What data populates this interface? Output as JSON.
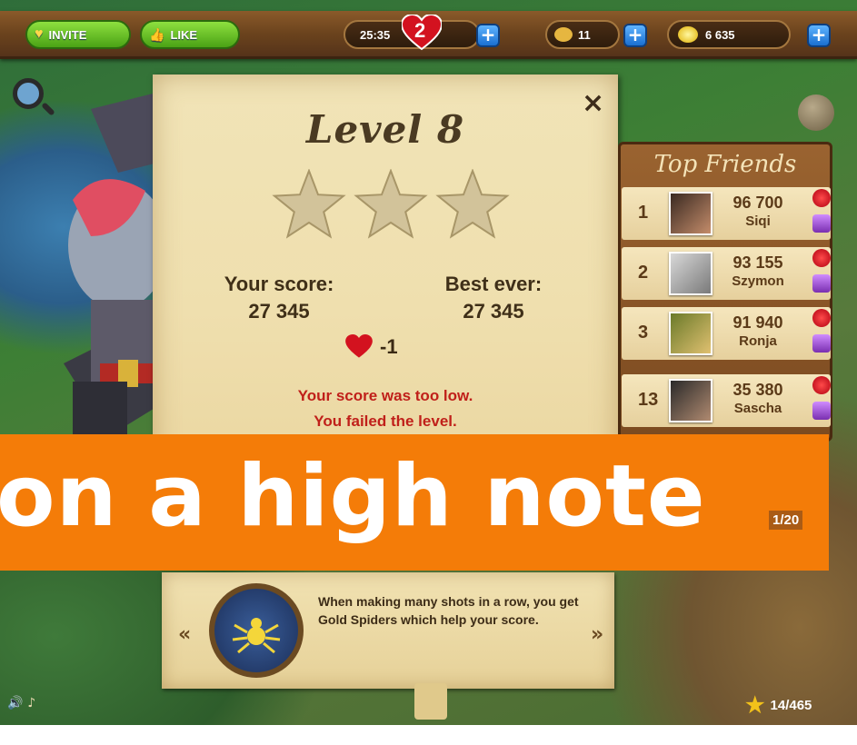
{
  "topbar": {
    "invite_label": "INVITE",
    "like_label": "LIKE",
    "timer": "25:35",
    "lives": "2",
    "tickets": "11",
    "coins": "6 635",
    "plus_symbol": "+"
  },
  "dialog": {
    "title": "Level 8",
    "close_symbol": "×",
    "stars_earned": 0,
    "stars_total": 3,
    "your_score_label": "Your score:",
    "your_score": "27 345",
    "best_ever_label": "Best ever:",
    "best_ever": "27 345",
    "lives_change": "-1",
    "fail_line1": "Your score was too low.",
    "fail_line2": "You failed the level."
  },
  "friends": {
    "title": "Top Friends",
    "rows": [
      {
        "rank": "1",
        "score": "96 700",
        "name": "Siqi"
      },
      {
        "rank": "2",
        "score": "93 155",
        "name": "Szymon"
      },
      {
        "rank": "3",
        "score": "91 940",
        "name": "Ronja"
      },
      {
        "rank": "13",
        "score": "35 380",
        "name": "Sascha"
      }
    ],
    "pager": "1/20"
  },
  "banner": {
    "text": "on a high note",
    "color": "#f47c08"
  },
  "tip": {
    "text": "When making many shots in a row, you get Gold Spiders which help your score.",
    "prev_arrow": "«",
    "next_arrow": "»"
  },
  "footer": {
    "sound_icons": "🔊 ♪",
    "progress": "14/465"
  }
}
